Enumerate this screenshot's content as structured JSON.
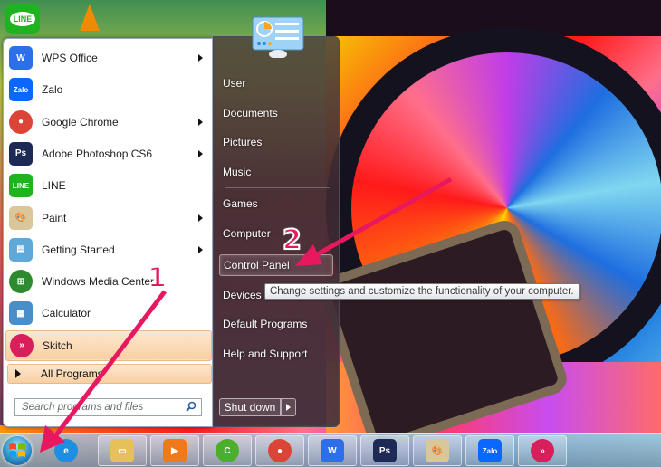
{
  "desktop": {
    "icons": [
      {
        "name": "LINE",
        "icon": "line-icon"
      },
      {
        "name": "VLC",
        "icon": "vlc-cone-icon"
      }
    ]
  },
  "start_menu": {
    "pinned": [
      {
        "label": "WPS Office",
        "icon": "wps-office-icon",
        "submenu": true,
        "color": "#2c6fe8",
        "glyph": "W"
      },
      {
        "label": "Zalo",
        "icon": "zalo-icon",
        "submenu": false,
        "color": "#0a68ff",
        "glyph": "Zalo"
      },
      {
        "label": "Google Chrome",
        "icon": "chrome-icon",
        "submenu": true,
        "color": "#db4437",
        "glyph": "●"
      },
      {
        "label": "Adobe Photoshop CS6",
        "icon": "photoshop-icon",
        "submenu": true,
        "color": "#1c2a55",
        "glyph": "Ps"
      },
      {
        "label": "LINE",
        "icon": "line-icon",
        "submenu": false,
        "color": "#1fb31f",
        "glyph": "LINE"
      },
      {
        "label": "Paint",
        "icon": "paint-palette-icon",
        "submenu": true,
        "color": "#d9c79a",
        "glyph": "🎨"
      },
      {
        "label": "Getting Started",
        "icon": "getting-started-icon",
        "submenu": true,
        "color": "#5fa8d8",
        "glyph": "▤"
      },
      {
        "label": "Windows Media Center",
        "icon": "windows-media-center-icon",
        "submenu": false,
        "color": "#2e8a2e",
        "glyph": "⊞"
      },
      {
        "label": "Calculator",
        "icon": "calculator-icon",
        "submenu": false,
        "color": "#4a8ec9",
        "glyph": "▦"
      },
      {
        "label": "Skitch",
        "icon": "skitch-icon",
        "submenu": false,
        "color": "#d81e5b",
        "glyph": "»",
        "highlighted": true
      }
    ],
    "all_programs_label": "All Programs",
    "search_placeholder": "Search programs and files",
    "right_items": [
      {
        "label": "User"
      },
      {
        "label": "Documents"
      },
      {
        "label": "Pictures"
      },
      {
        "label": "Music"
      },
      {
        "label": "Games"
      },
      {
        "label": "Computer"
      },
      {
        "label": "Control Panel",
        "highlighted": true
      },
      {
        "label": "Devices and Printers"
      },
      {
        "label": "Default Programs"
      },
      {
        "label": "Help and Support"
      }
    ],
    "shutdown_label": "Shut down",
    "tooltip": "Change settings and customize the functionality of your computer."
  },
  "taskbar": {
    "items": [
      {
        "name": "Internet Explorer",
        "icon": "internet-explorer-icon"
      },
      {
        "name": "Windows Explorer",
        "icon": "folder-icon"
      },
      {
        "name": "Windows Media Player",
        "icon": "media-player-icon"
      },
      {
        "name": "Coc Coc",
        "icon": "coccoc-browser-icon"
      },
      {
        "name": "Google Chrome",
        "icon": "chrome-icon"
      },
      {
        "name": "WPS Office",
        "icon": "wps-office-icon"
      },
      {
        "name": "Adobe Photoshop",
        "icon": "photoshop-icon"
      },
      {
        "name": "Paint",
        "icon": "paint-palette-icon"
      },
      {
        "name": "Zalo",
        "icon": "zalo-icon"
      },
      {
        "name": "Skitch",
        "icon": "skitch-icon"
      }
    ]
  },
  "annotations": {
    "step1": "1",
    "step2": "2",
    "arrow_color": "#e8185f"
  }
}
